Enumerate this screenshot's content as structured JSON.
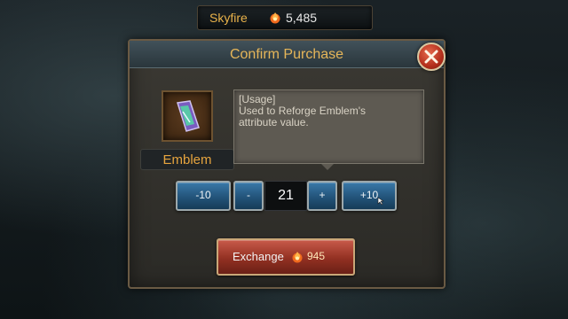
{
  "currency_bar": {
    "name": "Skyfire",
    "amount": "5,485",
    "icon": "flame-icon"
  },
  "dialog": {
    "title": "Confirm Purchase",
    "close_icon": "close-icon"
  },
  "item": {
    "name": "Emblem",
    "icon": "emblem-item-icon",
    "description_lines": [
      "[Usage]",
      "Used to Reforge Emblem's",
      "attribute value."
    ]
  },
  "quantity": {
    "minus10_label": "-10",
    "minus1_label": "-",
    "value": "21",
    "plus1_label": "+",
    "plus10_label": "+10"
  },
  "exchange": {
    "label": "Exchange",
    "cost": "945",
    "icon": "flame-icon"
  },
  "colors": {
    "accent_gold": "#e6b659",
    "button_blue": "#25577e",
    "button_red": "#923022"
  }
}
